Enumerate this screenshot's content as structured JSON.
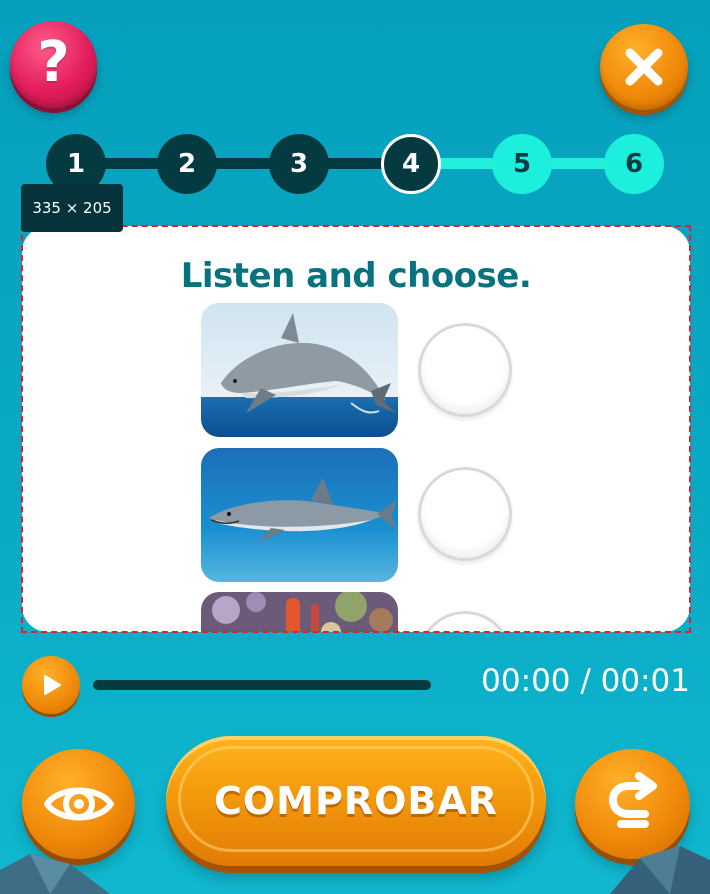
{
  "header": {
    "help_icon": "question-mark-icon",
    "help_glyph": "?",
    "close_icon": "close-x-icon"
  },
  "stepper": {
    "current_step": 4,
    "steps": [
      {
        "label": "1",
        "state": "done"
      },
      {
        "label": "2",
        "state": "done"
      },
      {
        "label": "3",
        "state": "done"
      },
      {
        "label": "4",
        "state": "current"
      },
      {
        "label": "5",
        "state": "todo"
      },
      {
        "label": "6",
        "state": "todo"
      }
    ]
  },
  "selection_size_label": "335 × 205",
  "card": {
    "title": "Listen and choose.",
    "options": [
      {
        "image": "dolphin-image",
        "selected": false
      },
      {
        "image": "shark-image",
        "selected": false
      },
      {
        "image": "coral-reef-image",
        "selected": false
      }
    ]
  },
  "audio": {
    "play_icon": "play-icon",
    "progress": 0,
    "time": "00:00 / 00:01"
  },
  "footer": {
    "eye_icon": "eye-icon",
    "check_label": "COMPROBAR",
    "next_icon": "redo-arrow-icon"
  },
  "colors": {
    "background": "#06a0bd",
    "step_done": "#053a41",
    "step_todo": "#1cf0dc",
    "title": "#08727f",
    "orange": "#f08a0a",
    "pink": "#e21d5b"
  }
}
